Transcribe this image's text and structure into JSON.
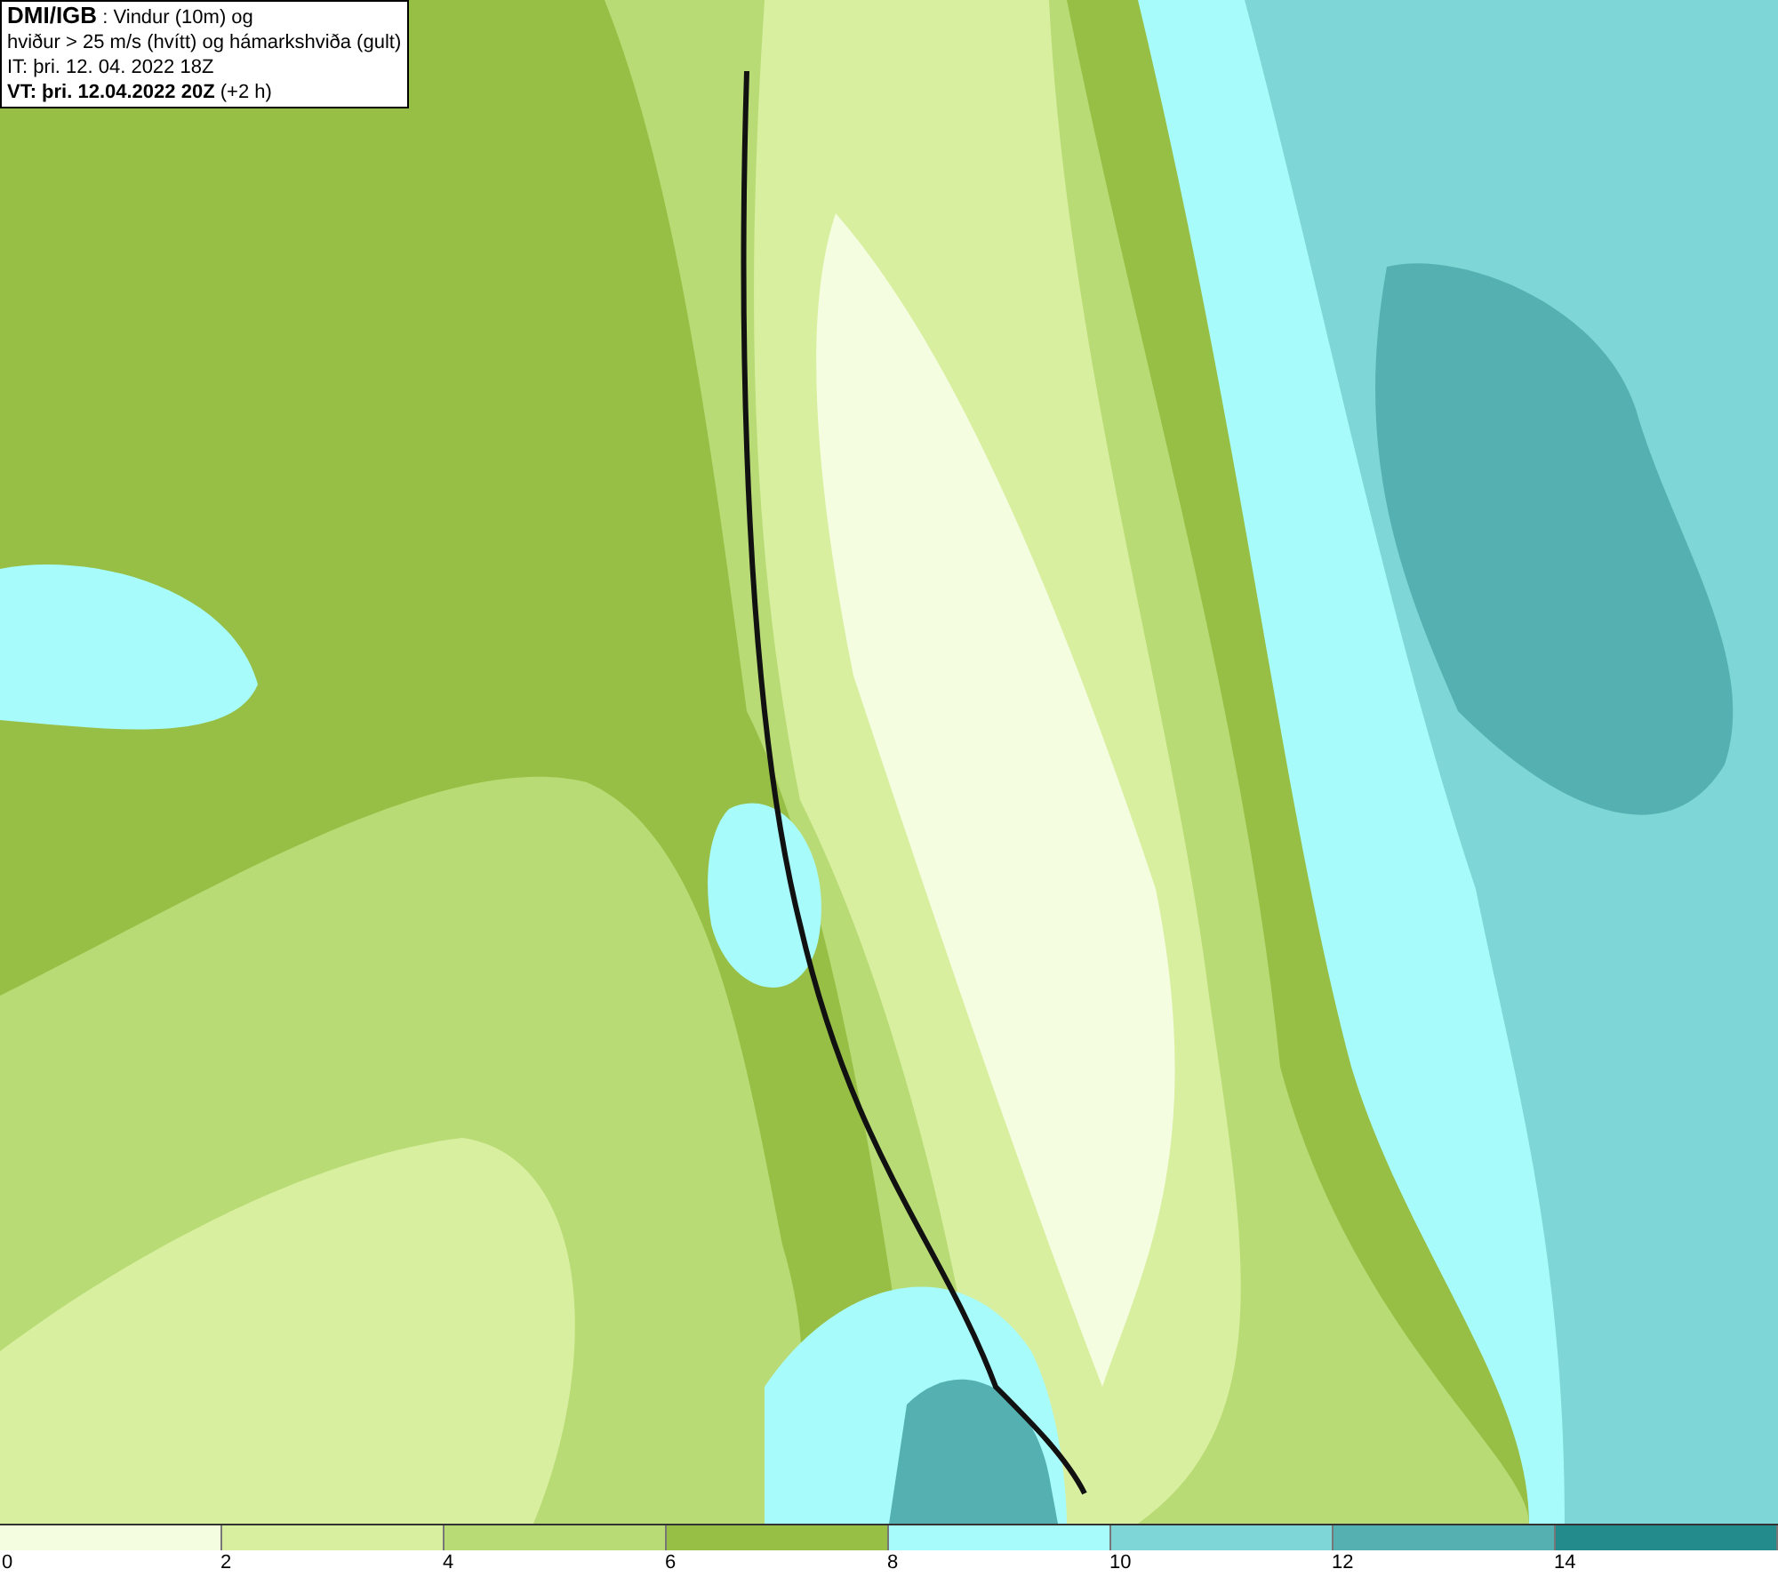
{
  "info_box": {
    "lines": [
      "**DMI/IGB** : Vindur (10m) og",
      "hviður > 25 m/s (hvítt) og hámarkshviða (gult)",
      "IT: þri. 12. 04. 2022 18Z",
      "**VT: þri. 12.04.2022 20Z** (+2 h)"
    ]
  },
  "legend": [
    {
      "label": "0",
      "color": "#f5fde0"
    },
    {
      "label": "2",
      "color": "#d8ef9f"
    },
    {
      "label": "4",
      "color": "#b8db75"
    },
    {
      "label": "6",
      "color": "#98bf45"
    },
    {
      "label": "8",
      "color": "#a8fbfb"
    },
    {
      "label": "10",
      "color": "#7fd6d6"
    },
    {
      "label": "12",
      "color": "#55b1b1"
    },
    {
      "label": "14",
      "color": "#238b8b"
    }
  ]
}
